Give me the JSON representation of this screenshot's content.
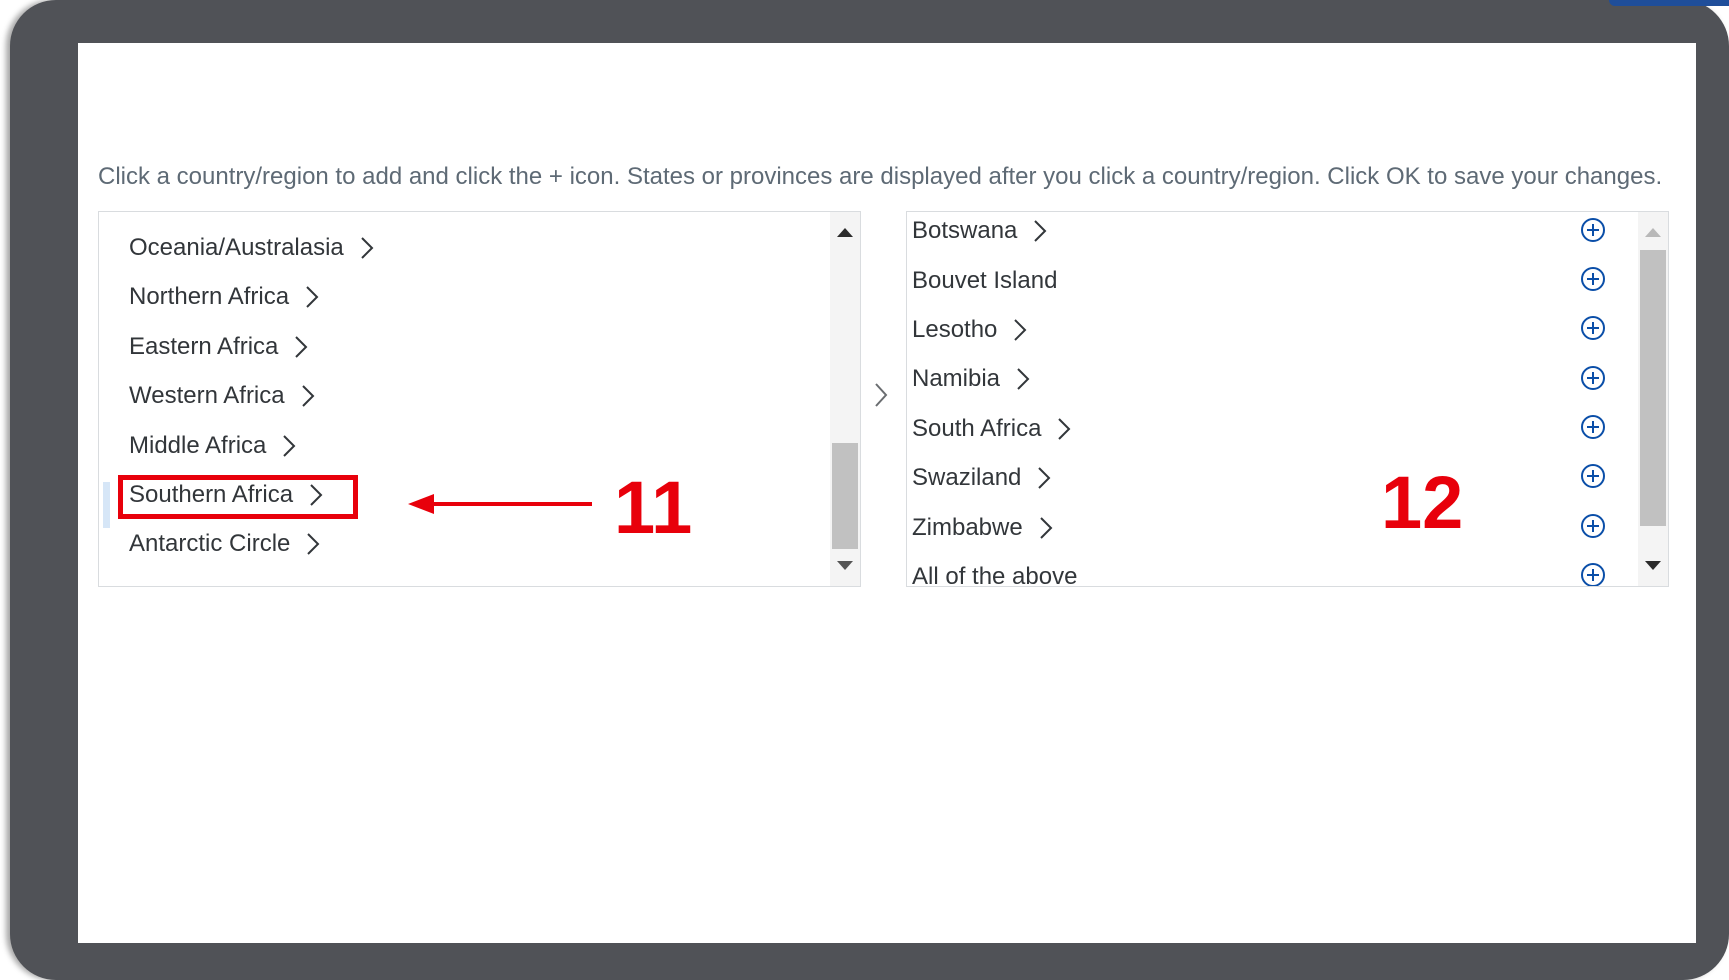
{
  "instruction": "Click a country/region to add and click the + icon. States or provinces are displayed after you click a country/region. Click OK to save your changes.",
  "left_list": {
    "items": [
      {
        "label": "Oceania/Australasia"
      },
      {
        "label": "Northern Africa"
      },
      {
        "label": "Eastern Africa"
      },
      {
        "label": "Western Africa"
      },
      {
        "label": "Middle Africa"
      },
      {
        "label": "Southern Africa"
      },
      {
        "label": "Antarctic Circle"
      }
    ],
    "selected": "Southern Africa"
  },
  "right_list": {
    "items": [
      {
        "label": "Botswana"
      },
      {
        "label": "Bouvet Island"
      },
      {
        "label": "Lesotho"
      },
      {
        "label": "Namibia"
      },
      {
        "label": "South Africa"
      },
      {
        "label": "Swaziland"
      },
      {
        "label": "Zimbabwe"
      },
      {
        "label": "All of the above"
      }
    ]
  },
  "annotations": {
    "step_left": "11",
    "step_right": "12",
    "highlight_color": "#e8000b"
  },
  "colors": {
    "add_icon": "#0a6ed1",
    "text": "#32363a",
    "frame": "#505257"
  }
}
